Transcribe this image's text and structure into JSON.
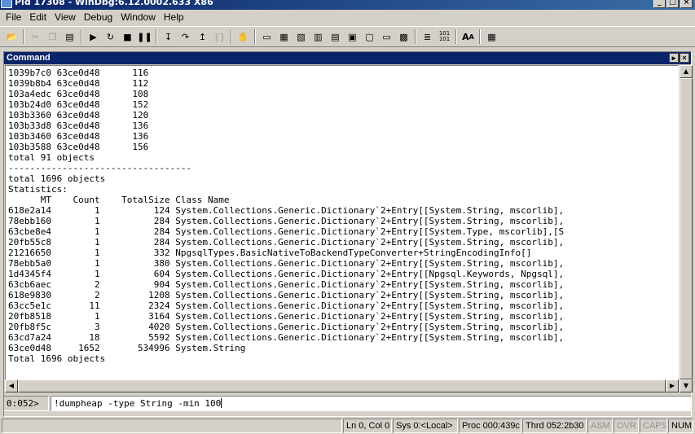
{
  "window": {
    "title": "Pid 17308 - WinDbg:6.12.0002.633 X86"
  },
  "menu": [
    "File",
    "Edit",
    "View",
    "Debug",
    "Window",
    "Help"
  ],
  "panel": {
    "title": "Command"
  },
  "output_lines": [
    "1039b7c0 63ce0d48      116",
    "1039b8b4 63ce0d48      112",
    "103a4edc 63ce0d48      108",
    "103b24d0 63ce0d48      152",
    "103b3360 63ce0d48      120",
    "103b33d8 63ce0d48      136",
    "103b3460 63ce0d48      136",
    "103b3588 63ce0d48      156",
    "total 91 objects",
    "----------------------------------",
    "total 1696 objects",
    "Statistics:",
    "      MT    Count    TotalSize Class Name",
    "618e2a14        1          124 System.Collections.Generic.Dictionary`2+Entry[[System.String, mscorlib],",
    "78ebb160        1          284 System.Collections.Generic.Dictionary`2+Entry[[System.String, mscorlib],",
    "63cbe8e4        1          284 System.Collections.Generic.Dictionary`2+Entry[[System.Type, mscorlib],[S",
    "20fb55c8        1          284 System.Collections.Generic.Dictionary`2+Entry[[System.String, mscorlib],",
    "21216650        1          332 NpgsqlTypes.BasicNativeToBackendTypeConverter+StringEncodingInfo[]",
    "78ebb5a0        1          380 System.Collections.Generic.Dictionary`2+Entry[[System.String, mscorlib],",
    "1d4345f4        1          604 System.Collections.Generic.Dictionary`2+Entry[[Npgsql.Keywords, Npgsql],",
    "63cb6aec        2          904 System.Collections.Generic.Dictionary`2+Entry[[System.String, mscorlib],",
    "618e9830        2         1208 System.Collections.Generic.Dictionary`2+Entry[[System.String, mscorlib],",
    "63cc5e1c       11         2324 System.Collections.Generic.Dictionary`2+Entry[[System.String, mscorlib],",
    "20fb8518        1         3164 System.Collections.Generic.Dictionary`2+Entry[[System.String, mscorlib],",
    "20fb8f5c        3         4020 System.Collections.Generic.Dictionary`2+Entry[[System.String, mscorlib],",
    "63cd7a24       18         5592 System.Collections.Generic.Dictionary`2+Entry[[System.String, mscorlib],",
    "63ce0d48     1652       534996 System.String",
    "Total 1696 objects"
  ],
  "command": {
    "prompt": "0:052>",
    "value": "!dumpheap -type String -min 100"
  },
  "status": {
    "ln_col": "Ln 0, Col 0",
    "sys": "Sys 0:<Local>",
    "proc": "Proc 000:439c",
    "thrd": "Thrd 052:2b30",
    "asm": "ASM",
    "ovr": "OVR",
    "caps": "CAPS",
    "num": "NUM"
  }
}
